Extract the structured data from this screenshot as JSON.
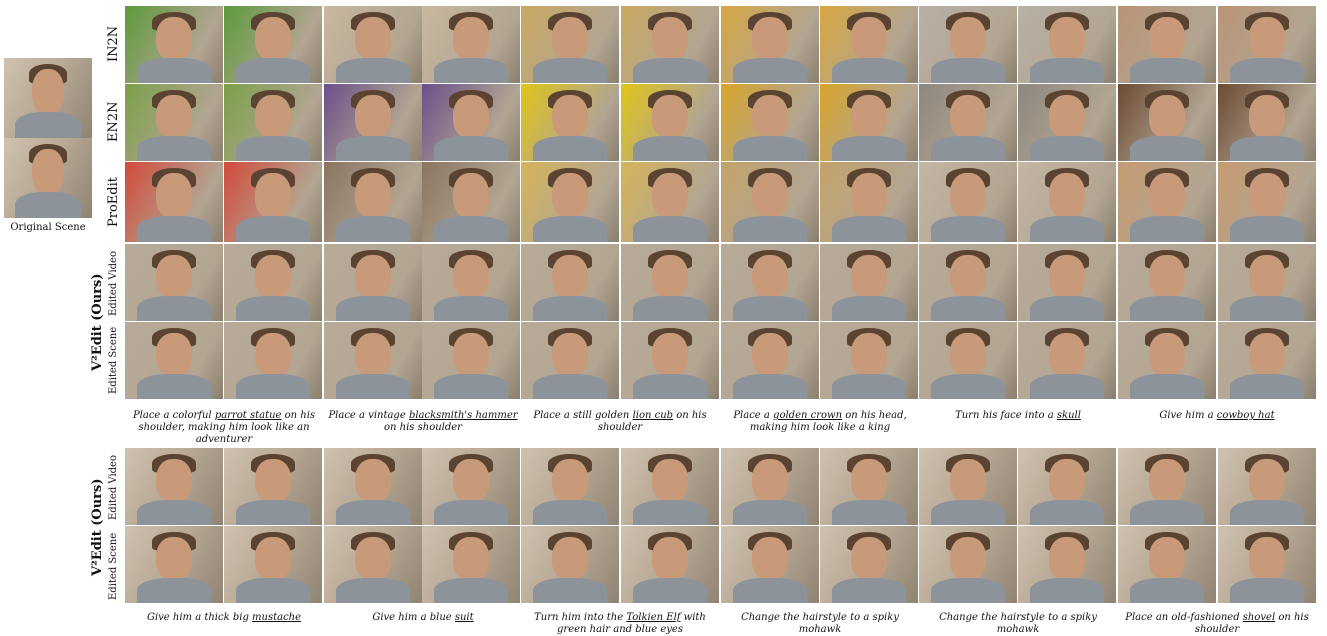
{
  "original": {
    "label": "Original Scene"
  },
  "top_block": {
    "row_labels": [
      "IN2N",
      "EN2N",
      "ProEdit",
      "Edited Video",
      "Edited Scene"
    ],
    "group_label": "V²Edit (Ours)",
    "captions": [
      {
        "pre": "Place a colorful ",
        "key": "parrot statue",
        "post": " on his shoulder, making him look like an adventurer"
      },
      {
        "pre": "Place a vintage ",
        "key": "blacksmith's hammer",
        "post": " on his shoulder"
      },
      {
        "pre": "Place a still golden ",
        "key": "lion cub",
        "post": " on his shoulder"
      },
      {
        "pre": "Place a ",
        "key": "golden crown",
        "post": " on his head, making him look like a king"
      },
      {
        "pre": "Turn his face into a ",
        "key": "skull",
        "post": ""
      },
      {
        "pre": "Give him a ",
        "key": "cowboy hat",
        "post": ""
      }
    ]
  },
  "bottom_block": {
    "row_labels": [
      "Edited Video",
      "Edited Scene"
    ],
    "group_label": "V²Edit (Ours)",
    "captions": [
      {
        "pre": "Give him a thick big ",
        "key": "mustache",
        "post": ""
      },
      {
        "pre": "Give him a blue ",
        "key": "suit",
        "post": ""
      },
      {
        "pre": "Turn him into the ",
        "key": "Tolkien Elf",
        "post": " with green hair and blue eyes"
      },
      {
        "pre": "Change the hairstyle to a spiky mohawk",
        "key": "",
        "post": ""
      },
      {
        "pre": "Change the hairstyle to a spiky mohawk",
        "key": "",
        "post": ""
      },
      {
        "pre": "Place an old-fashioned ",
        "key": "shovel",
        "post": " on his shoulder"
      }
    ]
  },
  "palette": {
    "top_rows": [
      [
        "#5c9a3a",
        "#c8b89e",
        "#c9a860",
        "#d6a640",
        "#b8b0a6",
        "#b99476"
      ],
      [
        "#7aa048",
        "#6a4f8a",
        "#e0c418",
        "#d8a52a",
        "#8e877f",
        "#6b4a32"
      ],
      [
        "#d24a3a",
        "#8a7560",
        "#d6b45a",
        "#c4a36a",
        "#c2b6a4",
        "#c69a70"
      ],
      [
        "#b8aa98",
        "#b8aa98",
        "#b8aa98",
        "#b8aa98",
        "#b8aa98",
        "#b8aa98"
      ],
      [
        "#b8aa98",
        "#b8aa98",
        "#b8aa98",
        "#b8aa98",
        "#b8aa98",
        "#b8aa98"
      ]
    ]
  }
}
